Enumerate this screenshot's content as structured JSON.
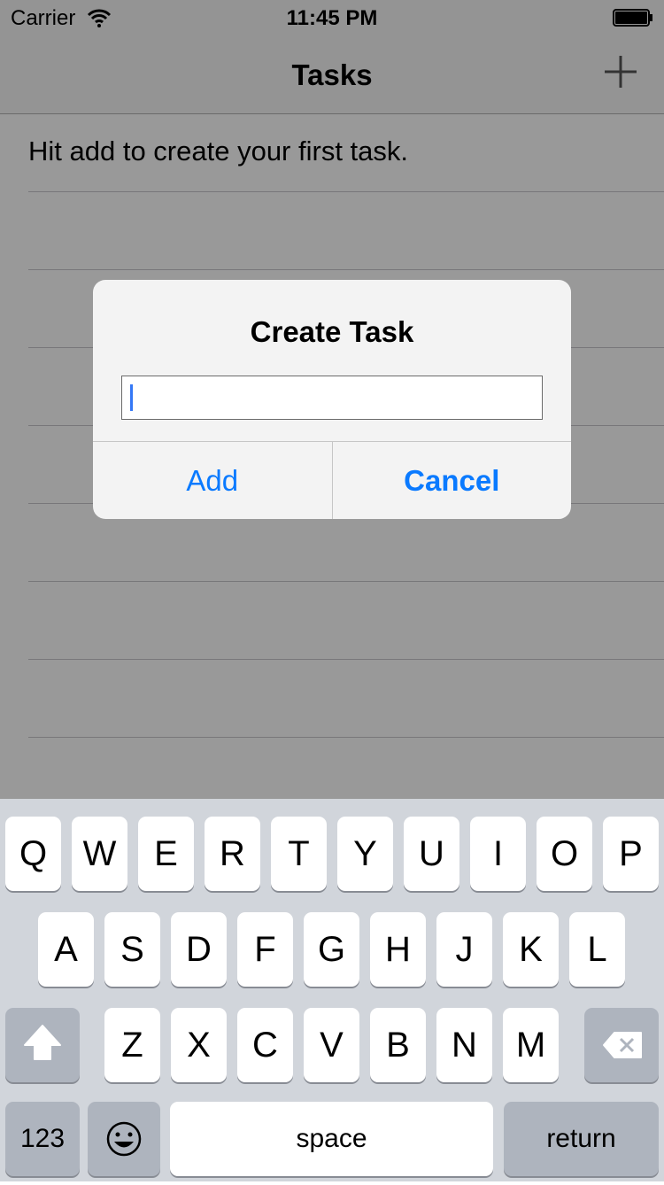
{
  "status_bar": {
    "carrier": "Carrier",
    "time": "11:45 PM"
  },
  "nav": {
    "title": "Tasks",
    "add_icon": "plus-icon"
  },
  "list": {
    "empty_message": "Hit add to create your first task."
  },
  "alert": {
    "title": "Create Task",
    "input_value": "",
    "add_label": "Add",
    "cancel_label": "Cancel"
  },
  "keyboard": {
    "row1": [
      "Q",
      "W",
      "E",
      "R",
      "T",
      "Y",
      "U",
      "I",
      "O",
      "P"
    ],
    "row2": [
      "A",
      "S",
      "D",
      "F",
      "G",
      "H",
      "J",
      "K",
      "L"
    ],
    "row3": [
      "Z",
      "X",
      "C",
      "V",
      "B",
      "N",
      "M"
    ],
    "numbers_label": "123",
    "space_label": "space",
    "return_label": "return",
    "shift_icon": "shift-arrow-icon",
    "delete_icon": "backspace-icon",
    "emoji_icon": "emoji-smiley-icon"
  },
  "colors": {
    "accent": "#0a7aff",
    "caret": "#3478f6",
    "keyboard_bg": "#d1d5db"
  }
}
